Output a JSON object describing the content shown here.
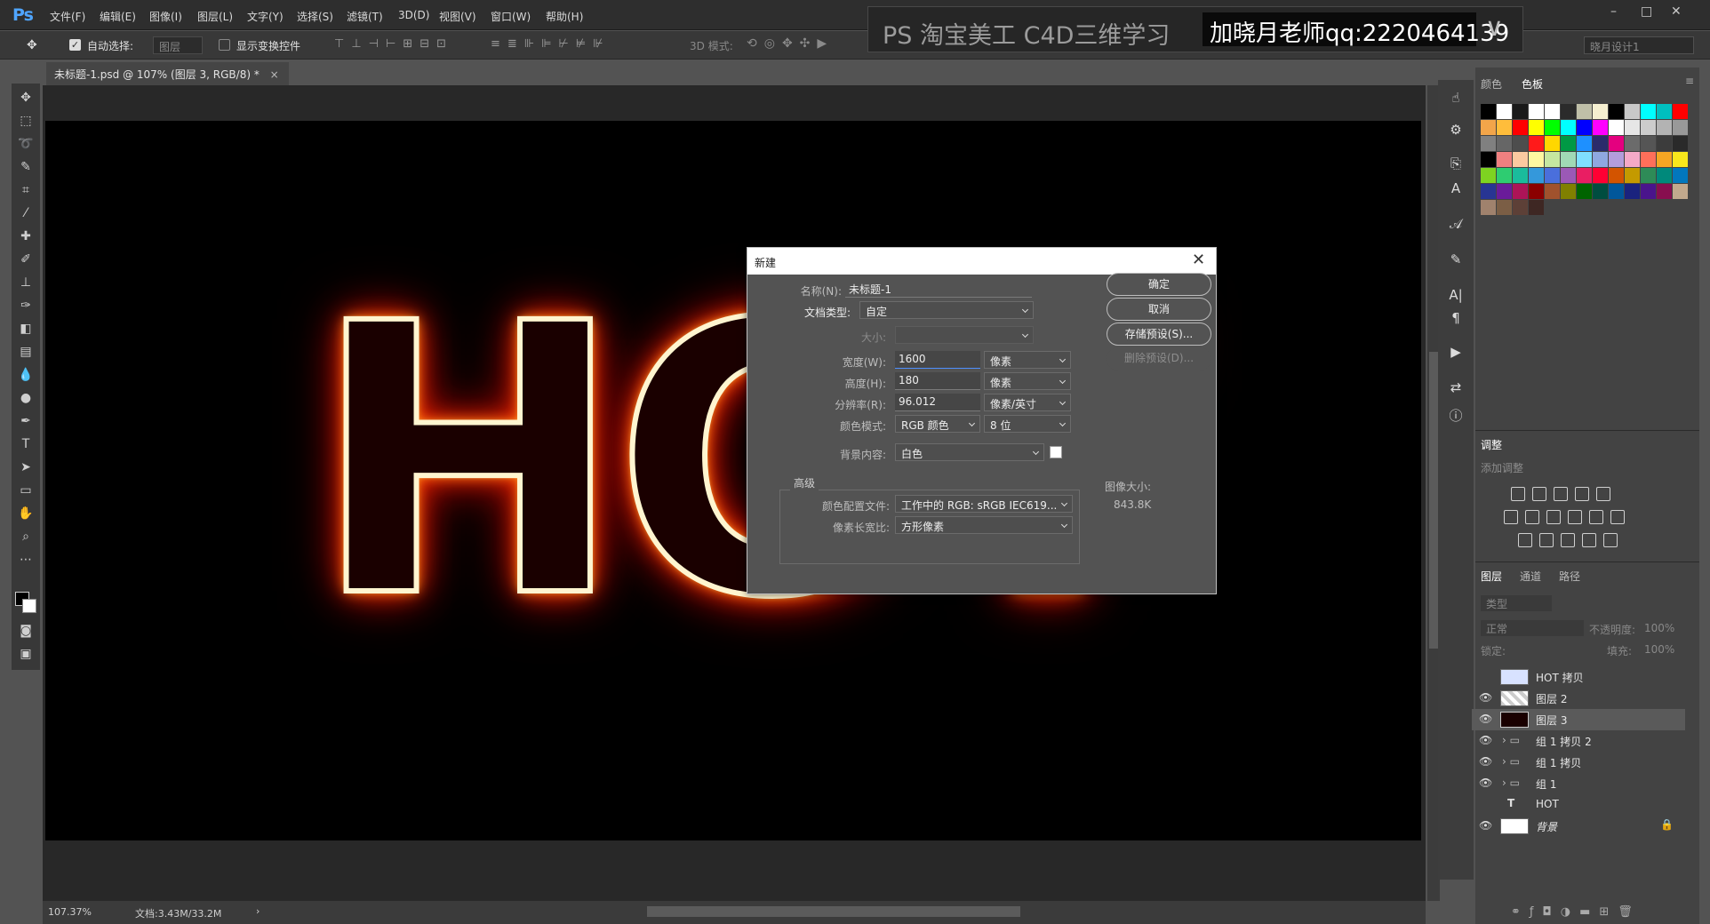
{
  "app": {
    "logo": "Ps"
  },
  "menu": [
    "文件(F)",
    "编辑(E)",
    "图像(I)",
    "图层(L)",
    "文字(Y)",
    "选择(S)",
    "滤镜(T)",
    "3D(D)",
    "视图(V)",
    "窗口(W)",
    "帮助(H)"
  ],
  "banner": {
    "text": "PS  淘宝美工  C4D三维学习",
    "qq": "加晓月老师qq:2220464139"
  },
  "options": {
    "auto_select": "自动选择:",
    "layer_select": "图层",
    "show_transform": "显示变换控件",
    "mode_3d": "3D 模式:",
    "workspace": "晓月设计1"
  },
  "document": {
    "tab_title": "未标题-1.psd @ 107% (图层 3, RGB/8) *",
    "zoom": "107.37%",
    "doc_size": "文档:3.43M/33.2M",
    "artwork_text": "HOT"
  },
  "dialog": {
    "title": "新建",
    "name_label": "名称(N):",
    "name_value": "未标题-1",
    "doc_type_label": "文档类型:",
    "doc_type_value": "自定",
    "size_label": "大小:",
    "width_label": "宽度(W):",
    "width_value": "1600",
    "width_unit": "像素",
    "height_label": "高度(H):",
    "height_value": "180",
    "height_unit": "像素",
    "resolution_label": "分辨率(R):",
    "resolution_value": "96.012",
    "resolution_unit": "像素/英寸",
    "color_mode_label": "颜色模式:",
    "color_mode_value": "RGB 颜色",
    "bit_depth": "8 位",
    "bg_label": "背景内容:",
    "bg_value": "白色",
    "advanced_label": "高级",
    "profile_label": "颜色配置文件:",
    "profile_value": "工作中的 RGB: sRGB IEC619...",
    "pixel_aspect_label": "像素长宽比:",
    "pixel_aspect_value": "方形像素",
    "image_size_label": "图像大小:",
    "image_size_value": "843.8K",
    "ok": "确定",
    "cancel": "取消",
    "save_preset": "存储预设(S)...",
    "delete_preset": "删除预设(D)..."
  },
  "panels": {
    "color_tab": "颜色",
    "swatch_tab": "色板",
    "adjust_title": "调整",
    "adjust_add": "添加调整",
    "layers_tab": "图层",
    "channels_tab": "通道",
    "paths_tab": "路径",
    "kind": "类型",
    "blend": "正常",
    "opacity_label": "不透明度:",
    "opacity": "100%",
    "lock_label": "锁定:",
    "fill_label": "填充:",
    "fill": "100%"
  },
  "layers": [
    {
      "name": "HOT 拷贝",
      "visible": false,
      "type": "image"
    },
    {
      "name": "图层 2",
      "visible": true,
      "type": "image"
    },
    {
      "name": "图层 3",
      "visible": true,
      "type": "image",
      "selected": true
    },
    {
      "name": "组 1 拷贝 2",
      "visible": true,
      "type": "group"
    },
    {
      "name": "组 1 拷贝",
      "visible": true,
      "type": "group"
    },
    {
      "name": "组 1",
      "visible": true,
      "type": "group"
    },
    {
      "name": "HOT",
      "visible": false,
      "type": "text"
    },
    {
      "name": "背景",
      "visible": true,
      "type": "background"
    }
  ],
  "swatch_colors": [
    "#000000",
    "#ffffff",
    "#1a1a1a",
    "#ffffff",
    "#ffffff",
    "#2b2b2b",
    "#bfbfa8",
    "#f5efd0",
    "#000000",
    "#c8c8c8",
    "#00ffff",
    "#00bfbf",
    "#ff0000",
    "#f2a54a",
    "#ffbd3b",
    "#ff0000",
    "#ffff00",
    "#00ff00",
    "#00ffff",
    "#0000ff",
    "#ff00ff",
    "#ffffff",
    "#e6e6e6",
    "#cccccc",
    "#b3b3b3",
    "#999999",
    "#808080",
    "#666666",
    "#4d4d4d",
    "#ff1a1a",
    "#ffd700",
    "#009944",
    "#1e90ff",
    "#2b2b6b",
    "#e4007f",
    "#6b6b6b",
    "#555555",
    "#3c3c3c",
    "#2a2a2a",
    "#000000",
    "#f08080",
    "#fbc9a0",
    "#fff7a0",
    "#c6e7a0",
    "#a0d9b5",
    "#7fdfff",
    "#8fa8e0",
    "#b39ddb",
    "#f5a9c8",
    "#ff6f5a",
    "#f5a623",
    "#f8e71c",
    "#7ed321",
    "#2ecc71",
    "#1abc9c",
    "#3498db",
    "#4a6fdc",
    "#9b59b6",
    "#e91e63",
    "#ff0033",
    "#d35400",
    "#c49a00",
    "#2e8b57",
    "#00897b",
    "#0277bd",
    "#283593",
    "#6a1b9a",
    "#ad1457",
    "#8b0000",
    "#a0522d",
    "#808000",
    "#006400",
    "#004d40",
    "#01579b",
    "#1a237e",
    "#4a148c",
    "#880e4f",
    "#c2a98d",
    "#a0826d",
    "#7b5e45",
    "#5d4037",
    "#3e2723"
  ]
}
